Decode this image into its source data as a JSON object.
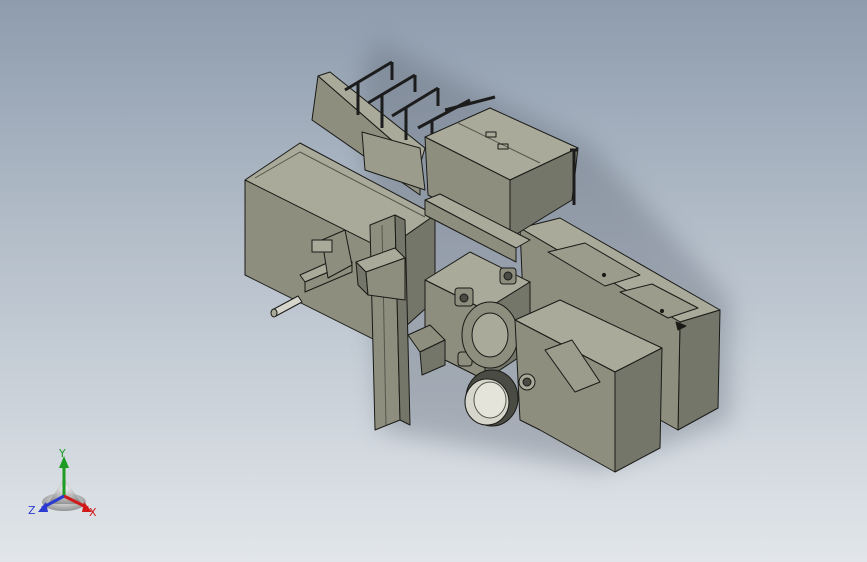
{
  "viewport": {
    "background_top": "#8e9cad",
    "background_bottom": "#e2e6ea"
  },
  "model": {
    "colors": {
      "top": "#a9aa99",
      "front": "#8d8e7e",
      "side": "#75766a",
      "dark": "#4a4b43",
      "edge": "#1a1a17",
      "rod": "#1c1c1c",
      "pipe": "#d6d6cc"
    }
  },
  "triad": {
    "y_label": "Y",
    "x_label": "X",
    "z_label": "Z",
    "colors": {
      "x": "#d01a1a",
      "y": "#1d9b22",
      "z": "#2b3ad0"
    }
  }
}
